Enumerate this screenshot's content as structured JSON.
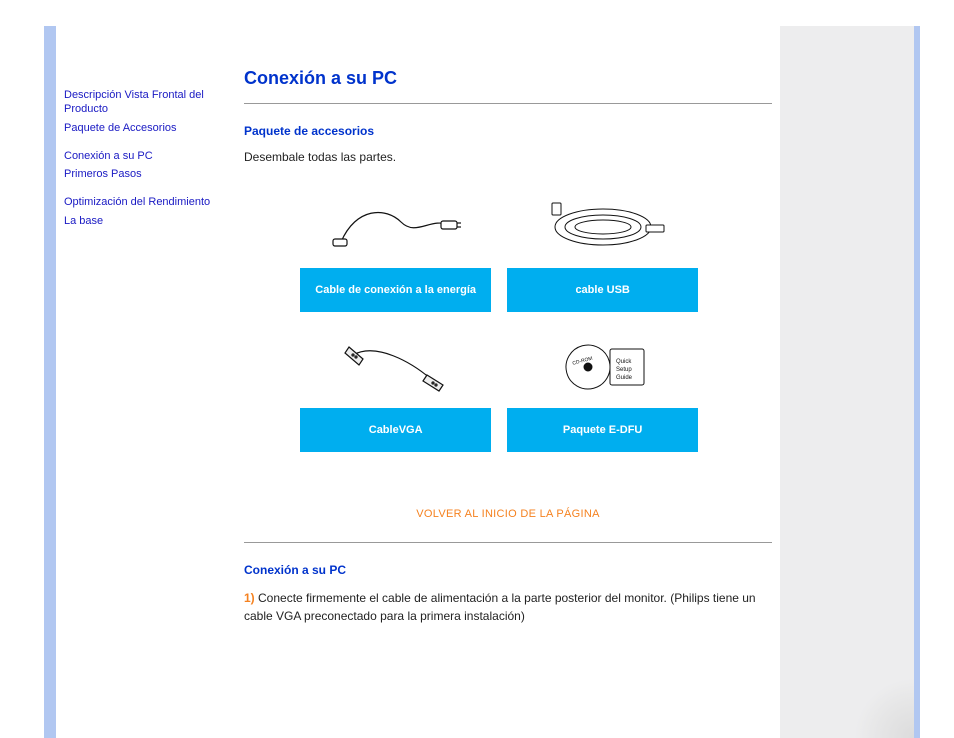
{
  "sidebar": {
    "items": [
      "Descripción Vista Frontal del Producto",
      "Paquete de Accesorios",
      "Conexión a su PC",
      "Primeros Pasos",
      "Optimización del Rendimiento",
      "La base"
    ]
  },
  "main": {
    "title": "Conexión a su PC",
    "section1_heading": "Paquete de accesorios",
    "section1_text": "Desembale todas las partes.",
    "grid": {
      "items": [
        {
          "label": "Cable de conexión a la energía"
        },
        {
          "label": "cable USB"
        },
        {
          "label": "CableVGA"
        },
        {
          "label": "Paquete E-DFU"
        }
      ]
    },
    "back_to_top": "VOLVER AL INICIO DE LA PÁGINA",
    "section2_heading": "Conexión a su PC",
    "step1_num": "1)",
    "step1_text": " Conecte firmemente el cable de alimentación a la parte posterior del monitor. (Philips tiene un cable VGA preconectado para la primera instalación)"
  }
}
